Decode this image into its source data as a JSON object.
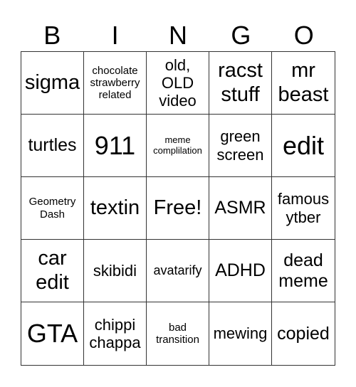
{
  "header": {
    "letters": [
      "B",
      "I",
      "N",
      "G",
      "O"
    ]
  },
  "card": {
    "rows": [
      [
        {
          "text": "sigma",
          "size": "xl"
        },
        {
          "text": "chocolate strawberry related",
          "size": "s"
        },
        {
          "text": "old, OLD video",
          "size": "m"
        },
        {
          "text": "racst stuff",
          "size": "xl"
        },
        {
          "text": "mr beast",
          "size": "xl"
        }
      ],
      [
        {
          "text": "turtles",
          "size": "l"
        },
        {
          "text": "911",
          "size": "xxl"
        },
        {
          "text": "meme complilation",
          "size": "xs"
        },
        {
          "text": "green screen",
          "size": "m"
        },
        {
          "text": "edit",
          "size": "xxl"
        }
      ],
      [
        {
          "text": "Geometry Dash",
          "size": "s"
        },
        {
          "text": "textin",
          "size": "xl"
        },
        {
          "text": "Free!",
          "size": "xl"
        },
        {
          "text": "ASMR",
          "size": "l"
        },
        {
          "text": "famous ytber",
          "size": "m"
        }
      ],
      [
        {
          "text": "car edit",
          "size": "xl"
        },
        {
          "text": "skibidi",
          "size": "m"
        },
        {
          "text": "avatarify",
          "size": "sm"
        },
        {
          "text": "ADHD",
          "size": "l"
        },
        {
          "text": "dead meme",
          "size": "l"
        }
      ],
      [
        {
          "text": "GTA",
          "size": "xxl"
        },
        {
          "text": "chippi chappa",
          "size": "m"
        },
        {
          "text": "bad transition",
          "size": "s"
        },
        {
          "text": "mewing",
          "size": "m"
        },
        {
          "text": "copied",
          "size": "l"
        }
      ]
    ]
  }
}
